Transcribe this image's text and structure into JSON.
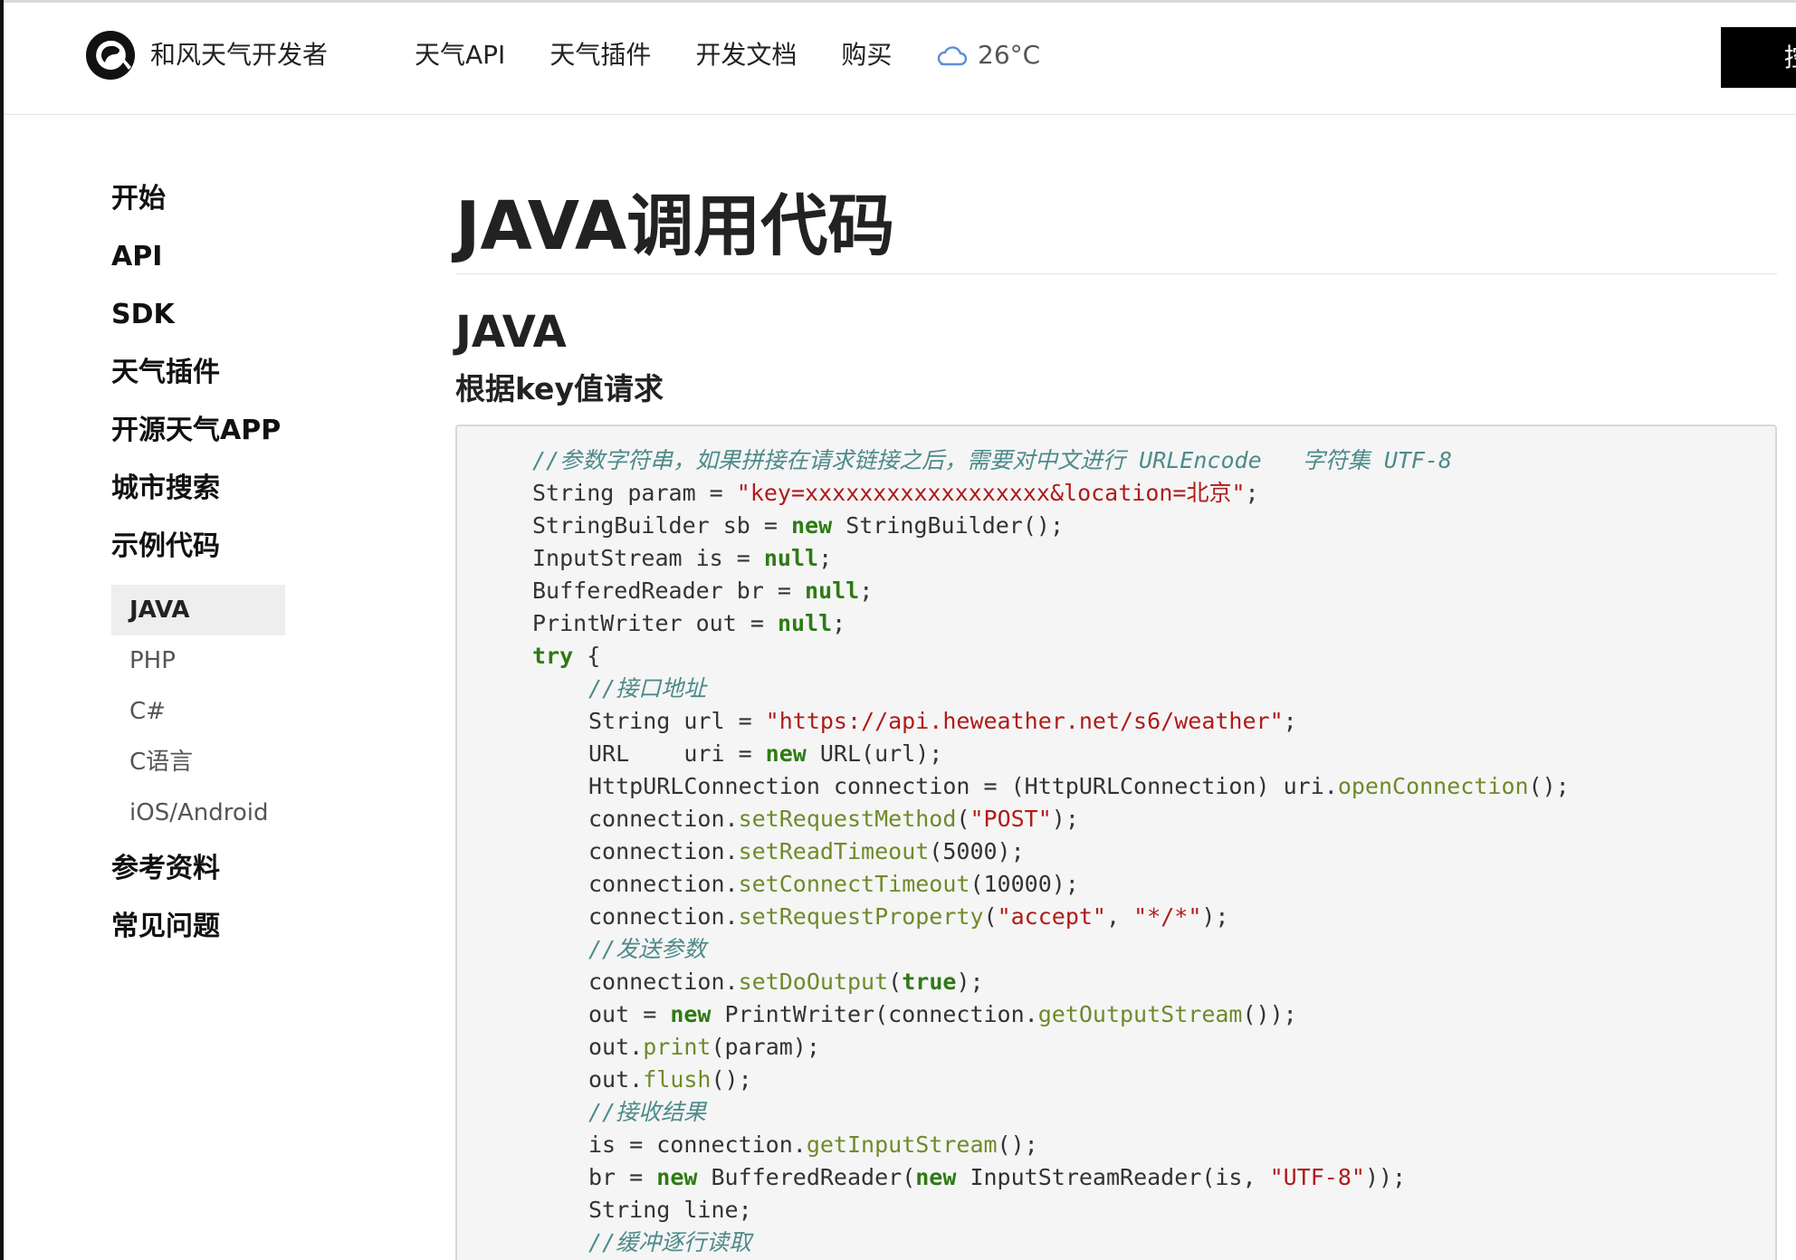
{
  "header": {
    "brand": "和风天气开发者",
    "nav": [
      "天气API",
      "天气插件",
      "开发文档",
      "购买"
    ],
    "weather": {
      "icon": "cloud-icon",
      "temperature": "26°C"
    },
    "button_label": "控"
  },
  "sidebar": {
    "sections_top": [
      "开始",
      "API",
      "SDK",
      "天气插件",
      "开源天气APP",
      "城市搜索",
      "示例代码"
    ],
    "sub_items": [
      "JAVA",
      "PHP",
      "C#",
      "C语言",
      "iOS/Android"
    ],
    "active_sub_item": "JAVA",
    "sections_bottom": [
      "参考资料",
      "常见问题"
    ]
  },
  "main": {
    "title": "JAVA调用代码",
    "section_title": "JAVA",
    "subsection_title": "根据key值请求"
  },
  "code": {
    "lines": [
      {
        "indent": 0,
        "tokens": [
          [
            "c",
            "//参数字符串，如果拼接在请求链接之后，需要对中文进行 URLEncode   字符集 UTF-8"
          ]
        ]
      },
      {
        "indent": 0,
        "tokens": [
          [
            "p",
            "String param = "
          ],
          [
            "s",
            "\"key=xxxxxxxxxxxxxxxxxx&location=北京\""
          ],
          [
            "p",
            ";"
          ]
        ]
      },
      {
        "indent": 0,
        "tokens": [
          [
            "p",
            "StringBuilder sb = "
          ],
          [
            "k",
            "new"
          ],
          [
            "p",
            " StringBuilder();"
          ]
        ]
      },
      {
        "indent": 0,
        "tokens": [
          [
            "p",
            "InputStream is = "
          ],
          [
            "k",
            "null"
          ],
          [
            "p",
            ";"
          ]
        ]
      },
      {
        "indent": 0,
        "tokens": [
          [
            "p",
            "BufferedReader br = "
          ],
          [
            "k",
            "null"
          ],
          [
            "p",
            ";"
          ]
        ]
      },
      {
        "indent": 0,
        "tokens": [
          [
            "p",
            "PrintWriter out = "
          ],
          [
            "k",
            "null"
          ],
          [
            "p",
            ";"
          ]
        ]
      },
      {
        "indent": 0,
        "tokens": [
          [
            "k",
            "try"
          ],
          [
            "p",
            " {"
          ]
        ]
      },
      {
        "indent": 1,
        "tokens": [
          [
            "c",
            "//接口地址"
          ]
        ]
      },
      {
        "indent": 1,
        "tokens": [
          [
            "p",
            "String url = "
          ],
          [
            "s",
            "\"https://api.heweather.net/s6/weather\""
          ],
          [
            "p",
            ";"
          ]
        ]
      },
      {
        "indent": 1,
        "tokens": [
          [
            "p",
            "URL    uri = "
          ],
          [
            "k",
            "new"
          ],
          [
            "p",
            " URL(url);"
          ]
        ]
      },
      {
        "indent": 1,
        "tokens": [
          [
            "p",
            "HttpURLConnection connection = (HttpURLConnection) uri."
          ],
          [
            "m",
            "openConnection"
          ],
          [
            "p",
            "();"
          ]
        ]
      },
      {
        "indent": 1,
        "tokens": [
          [
            "p",
            "connection."
          ],
          [
            "m",
            "setRequestMethod"
          ],
          [
            "p",
            "("
          ],
          [
            "s",
            "\"POST\""
          ],
          [
            "p",
            ");"
          ]
        ]
      },
      {
        "indent": 1,
        "tokens": [
          [
            "p",
            "connection."
          ],
          [
            "m",
            "setReadTimeout"
          ],
          [
            "p",
            "(5000);"
          ]
        ]
      },
      {
        "indent": 1,
        "tokens": [
          [
            "p",
            "connection."
          ],
          [
            "m",
            "setConnectTimeout"
          ],
          [
            "p",
            "(10000);"
          ]
        ]
      },
      {
        "indent": 1,
        "tokens": [
          [
            "p",
            "connection."
          ],
          [
            "m",
            "setRequestProperty"
          ],
          [
            "p",
            "("
          ],
          [
            "s",
            "\"accept\""
          ],
          [
            "p",
            ", "
          ],
          [
            "s",
            "\"*/*\""
          ],
          [
            "p",
            ");"
          ]
        ]
      },
      {
        "indent": 1,
        "tokens": [
          [
            "c",
            "//发送参数"
          ]
        ]
      },
      {
        "indent": 1,
        "tokens": [
          [
            "p",
            "connection."
          ],
          [
            "m",
            "setDoOutput"
          ],
          [
            "p",
            "("
          ],
          [
            "k",
            "true"
          ],
          [
            "p",
            ");"
          ]
        ]
      },
      {
        "indent": 1,
        "tokens": [
          [
            "p",
            "out = "
          ],
          [
            "k",
            "new"
          ],
          [
            "p",
            " PrintWriter(connection."
          ],
          [
            "m",
            "getOutputStream"
          ],
          [
            "p",
            "());"
          ]
        ]
      },
      {
        "indent": 1,
        "tokens": [
          [
            "p",
            "out."
          ],
          [
            "m",
            "print"
          ],
          [
            "p",
            "(param);"
          ]
        ]
      },
      {
        "indent": 1,
        "tokens": [
          [
            "p",
            "out."
          ],
          [
            "m",
            "flush"
          ],
          [
            "p",
            "();"
          ]
        ]
      },
      {
        "indent": 1,
        "tokens": [
          [
            "c",
            "//接收结果"
          ]
        ]
      },
      {
        "indent": 1,
        "tokens": [
          [
            "p",
            "is = connection."
          ],
          [
            "m",
            "getInputStream"
          ],
          [
            "p",
            "();"
          ]
        ]
      },
      {
        "indent": 1,
        "tokens": [
          [
            "p",
            "br = "
          ],
          [
            "k",
            "new"
          ],
          [
            "p",
            " BufferedReader("
          ],
          [
            "k",
            "new"
          ],
          [
            "p",
            " InputStreamReader(is, "
          ],
          [
            "s",
            "\"UTF-8\""
          ],
          [
            "p",
            "));"
          ]
        ]
      },
      {
        "indent": 1,
        "tokens": [
          [
            "p",
            "String line;"
          ]
        ]
      },
      {
        "indent": 1,
        "tokens": [
          [
            "c",
            "//缓冲逐行读取"
          ]
        ]
      }
    ]
  },
  "colors": {
    "comment": "#4e8a8a",
    "string": "#b11a1a",
    "keyword": "#2e7a14",
    "method": "#6f8a2a",
    "active_bg": "#eeeeee"
  }
}
